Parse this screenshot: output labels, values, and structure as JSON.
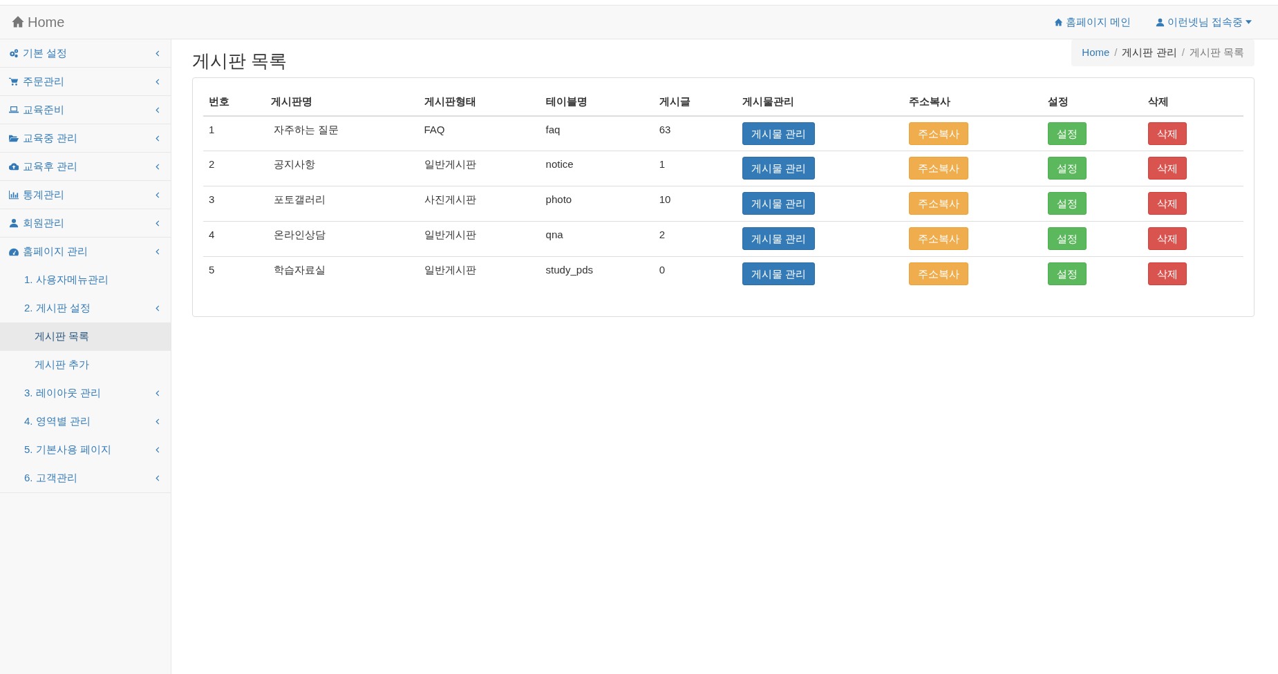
{
  "navbar": {
    "brand": "Home",
    "links": [
      {
        "label": "홈페이지 메인",
        "kind": "home",
        "caret": false
      },
      {
        "label": "이런넷님 접속중",
        "kind": "user",
        "caret": true
      }
    ]
  },
  "sidebar": {
    "items": [
      {
        "label": "기본 설정",
        "kind": "gears",
        "submenu": true,
        "selected": false
      },
      {
        "label": "주문관리",
        "kind": "cart",
        "submenu": true,
        "selected": false
      },
      {
        "label": "교육준비",
        "kind": "laptop",
        "submenu": true,
        "selected": false
      },
      {
        "label": "교육중 관리",
        "kind": "folder",
        "submenu": true,
        "selected": false
      },
      {
        "label": "교육후 관리",
        "kind": "cloud",
        "submenu": true,
        "selected": false
      },
      {
        "label": "통계관리",
        "kind": "chart",
        "submenu": true,
        "selected": false
      },
      {
        "label": "회원관리",
        "kind": "user",
        "submenu": true,
        "selected": false
      },
      {
        "label": "홈페이지 관리",
        "kind": "dashboard",
        "submenu": true,
        "selected": false,
        "children": [
          {
            "label": "1. 사용자메뉴관리",
            "submenu": false,
            "selected": false
          },
          {
            "label": "2. 게시판 설정",
            "submenu": true,
            "selected": false,
            "children": [
              {
                "label": "게시판 목록",
                "submenu": false,
                "selected": true
              },
              {
                "label": "게시판 추가",
                "submenu": false,
                "selected": false
              }
            ]
          },
          {
            "label": "3. 레이아웃 관리",
            "submenu": true,
            "selected": false
          },
          {
            "label": "4. 영역별 관리",
            "submenu": true,
            "selected": false
          },
          {
            "label": "5. 기본사용 페이지",
            "submenu": true,
            "selected": false
          },
          {
            "label": "6. 고객관리",
            "submenu": true,
            "selected": false
          }
        ]
      }
    ]
  },
  "page": {
    "title": "게시판 목록",
    "breadcrumb": [
      {
        "label": "Home",
        "kind": "link"
      },
      {
        "label": "/",
        "kind": "separator"
      },
      {
        "label": "게시판 관리",
        "kind": "text"
      },
      {
        "label": "/",
        "kind": "separator"
      },
      {
        "label": "게시판 목록",
        "kind": "current"
      }
    ]
  },
  "table": {
    "columns": [
      "번호",
      "게시판명",
      "게시판형태",
      "테이블명",
      "게시글",
      "게시물관리",
      "주소복사",
      "설정",
      "삭제"
    ],
    "rows": [
      {
        "cells": [
          "1",
          "자주하는 질문",
          "FAQ",
          "faq",
          "63"
        ],
        "actions": [
          {
            "label": "게시물 관리",
            "kind": "primary"
          },
          {
            "label": "주소복사",
            "kind": "warning"
          },
          {
            "label": "설정",
            "kind": "success"
          },
          {
            "label": "삭제",
            "kind": "danger"
          }
        ]
      },
      {
        "cells": [
          "2",
          "공지사항",
          "일반게시판",
          "notice",
          "1"
        ],
        "actions": [
          {
            "label": "게시물 관리",
            "kind": "primary"
          },
          {
            "label": "주소복사",
            "kind": "warning"
          },
          {
            "label": "설정",
            "kind": "success"
          },
          {
            "label": "삭제",
            "kind": "danger"
          }
        ]
      },
      {
        "cells": [
          "3",
          "포토갤러리",
          "사진게시판",
          "photo",
          "10"
        ],
        "actions": [
          {
            "label": "게시물 관리",
            "kind": "primary"
          },
          {
            "label": "주소복사",
            "kind": "warning"
          },
          {
            "label": "설정",
            "kind": "success"
          },
          {
            "label": "삭제",
            "kind": "danger"
          }
        ]
      },
      {
        "cells": [
          "4",
          "온라인상담",
          "일반게시판",
          "qna",
          "2"
        ],
        "actions": [
          {
            "label": "게시물 관리",
            "kind": "primary"
          },
          {
            "label": "주소복사",
            "kind": "warning"
          },
          {
            "label": "설정",
            "kind": "success"
          },
          {
            "label": "삭제",
            "kind": "danger"
          }
        ]
      },
      {
        "cells": [
          "5",
          "학습자료실",
          "일반게시판",
          "study_pds",
          "0"
        ],
        "actions": [
          {
            "label": "게시물 관리",
            "kind": "primary"
          },
          {
            "label": "주소복사",
            "kind": "warning"
          },
          {
            "label": "설정",
            "kind": "success"
          },
          {
            "label": "삭제",
            "kind": "danger"
          }
        ]
      }
    ]
  }
}
